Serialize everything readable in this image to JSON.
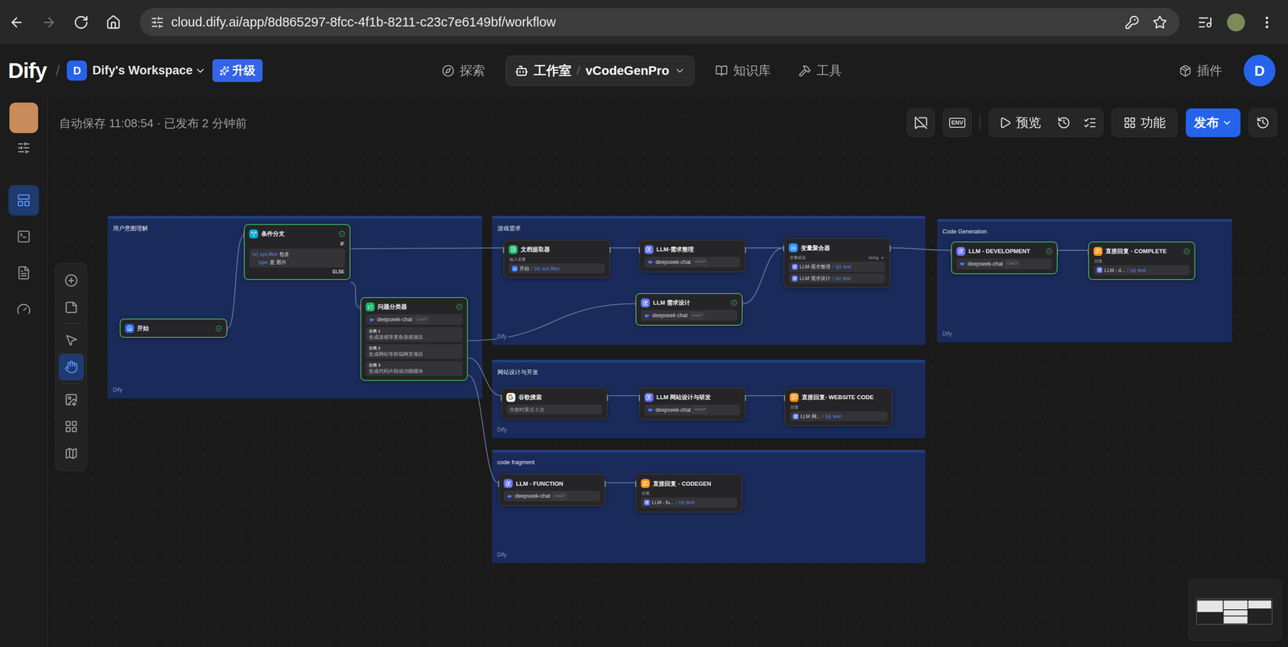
{
  "browser": {
    "url": "cloud.dify.ai/app/8d865297-8fcc-4f1b-8211-c23c7e6149bf/workflow"
  },
  "header": {
    "logo": "Dify",
    "separator": "/",
    "workspace": {
      "initial": "D",
      "name": "Dify's Workspace"
    },
    "upgrade": "升级",
    "nav": [
      {
        "label": "探索",
        "selected": false
      },
      {
        "label": "工作室",
        "selected": true,
        "separator": "/",
        "app": "vCodeGenPro"
      },
      {
        "label": "知识库",
        "selected": false
      },
      {
        "label": "工具",
        "selected": false
      }
    ],
    "plugins": "插件",
    "avatar": "D"
  },
  "sidebar": {
    "items": [
      {
        "selected": true
      },
      {
        "selected": false
      },
      {
        "selected": false
      },
      {
        "selected": false
      }
    ]
  },
  "toolbar": {
    "status": "自动保存 11:08:54 · 已发布 2 分钟前",
    "env": "ENV",
    "preview": "预览",
    "features": "功能",
    "publish": "发布"
  },
  "palette": {
    "tools": [
      {
        "selected": false
      },
      {
        "selected": false
      },
      {
        "selected": false
      },
      {
        "selected": true
      },
      {
        "selected": false
      },
      {
        "selected": false
      },
      {
        "selected": false
      }
    ]
  },
  "groups": [
    {
      "title": "用户意图理解",
      "footer": "Dify"
    },
    {
      "title": "游戏需求",
      "footer": "Dify"
    },
    {
      "title": "网站设计与开发",
      "footer": "Dify"
    },
    {
      "title": "code fragment",
      "footer": "Dify"
    },
    {
      "title": "Code Generation",
      "footer": "Dify"
    }
  ],
  "nodes": [
    {
      "kind": "start",
      "title": "开始",
      "succeeded": true
    },
    {
      "kind": "if",
      "title": "条件分支",
      "succeeded": true,
      "if_label": "IF",
      "else_label": "ELSE",
      "condition": {
        "var_icon": "{x}",
        "var": "sys.files",
        "operator": "包含",
        "key": "type",
        "key_operator": "是",
        "value": "图片"
      }
    },
    {
      "kind": "classifier",
      "title": "问题分类器",
      "succeeded": true,
      "model": "deepseek-chat",
      "mode": "CHAT",
      "classes": [
        {
          "label": "分类 1",
          "text": "生成游戏等复杂游戏项目"
        },
        {
          "label": "分类 2",
          "text": "生成网站等前端网页项目"
        },
        {
          "label": "分类 3",
          "text": "生成代码片段或功能模块"
        }
      ]
    },
    {
      "kind": "extractor",
      "title": "文档提取器",
      "succeeded": false,
      "label": "输入变量",
      "input": {
        "source_kind": "start",
        "node": "开始",
        "separator": "/",
        "var_icon": "{x}",
        "var": "sys.files"
      }
    },
    {
      "kind": "llm",
      "title": "LLM-需求整理",
      "succeeded": false,
      "model": "deepseek-chat",
      "mode": "CHAT"
    },
    {
      "kind": "llm",
      "title": "LLM 需求设计",
      "succeeded": true,
      "model": "deepseek-chat",
      "mode": "CHAT"
    },
    {
      "kind": "aggregator",
      "title": "变量聚合器",
      "succeeded": false,
      "label": "变量赋值",
      "type": "string",
      "add": "+",
      "inputs": [
        {
          "source_kind": "llm",
          "node": "LLM-需求整理",
          "separator": "/",
          "var_icon": "{x}",
          "var": "text"
        },
        {
          "source_kind": "llm",
          "node": "LLM 需求设计",
          "separator": "/",
          "var_icon": "{x}",
          "var": "text"
        }
      ]
    },
    {
      "kind": "llm",
      "title": "LLM - DEVELOPMENT",
      "succeeded": true,
      "model": "deepseek-chat",
      "mode": "CHAT"
    },
    {
      "kind": "answer",
      "title": "直接回复 - COMPLETE",
      "succeeded": true,
      "label": "回复",
      "input": {
        "source_kind": "llm",
        "node": "LLM - d...",
        "separator": "/",
        "var_icon": "{x}",
        "var": "text"
      }
    },
    {
      "kind": "tool",
      "title": "谷歌搜索",
      "succeeded": false,
      "note": "失败时重试 3 次"
    },
    {
      "kind": "llm",
      "title": "LLM 网站设计与研发",
      "succeeded": false,
      "model": "deepseek-chat",
      "mode": "CHAT"
    },
    {
      "kind": "answer",
      "title": "直接回复- WEBSITE CODE",
      "succeeded": false,
      "label": "回复",
      "input": {
        "source_kind": "llm",
        "node": "LLM 网...",
        "separator": "/",
        "var_icon": "{x}",
        "var": "text"
      }
    },
    {
      "kind": "llm",
      "title": "LLM - FUNCTION",
      "succeeded": false,
      "model": "deepseek-chat",
      "mode": "CHAT"
    },
    {
      "kind": "answer",
      "title": "直接回复 - CODEGEN",
      "succeeded": false,
      "label": "回复",
      "input": {
        "source_kind": "llm",
        "node": "LLM - fu...",
        "separator": "/",
        "var_icon": "{x}",
        "var": "text"
      }
    }
  ]
}
